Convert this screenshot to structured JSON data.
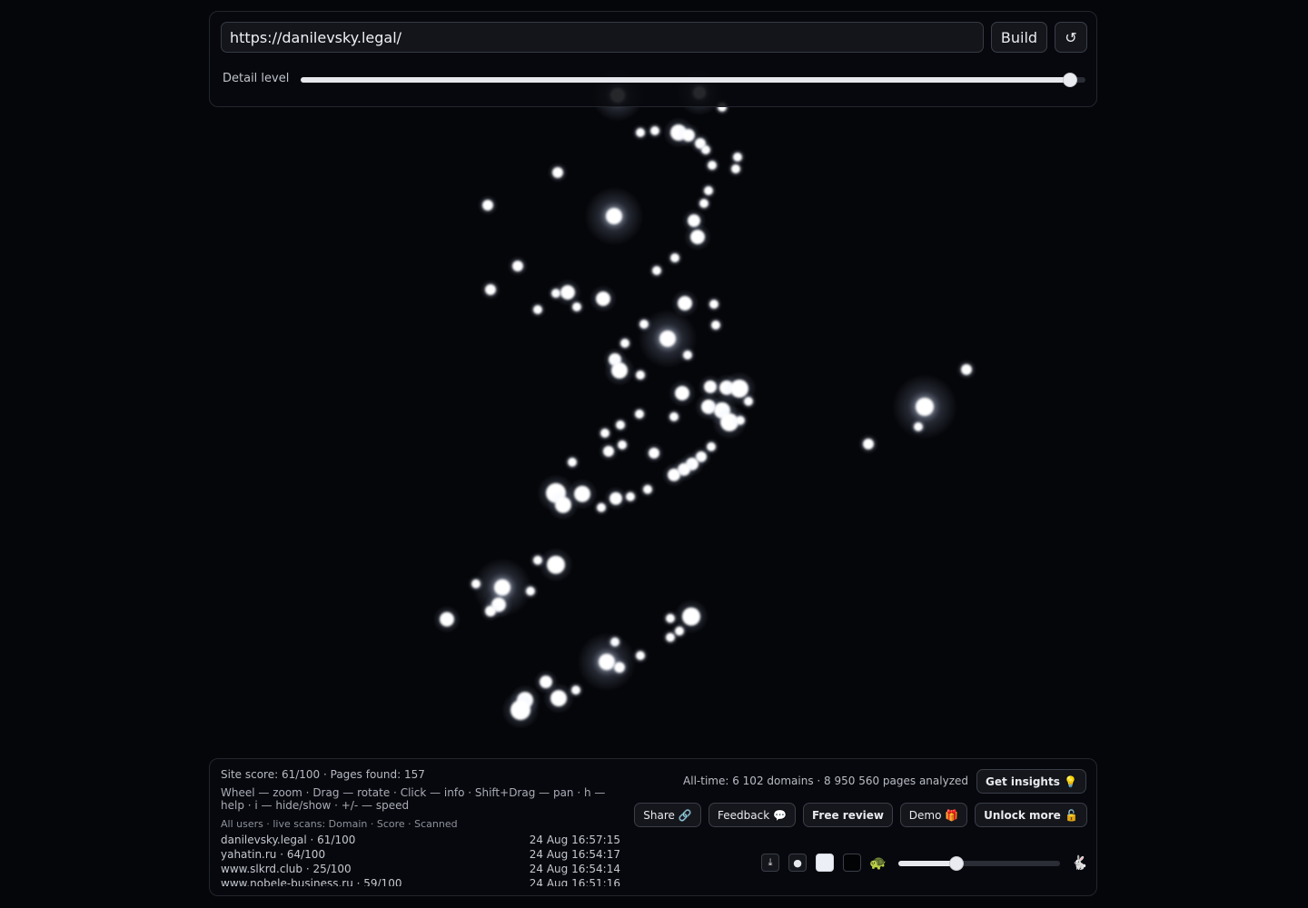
{
  "toolbar": {
    "url_value": "https://danilevsky.legal/",
    "build_label": "Build",
    "refresh_icon": "↺",
    "detail_label": "Detail level",
    "detail_value": 0.98
  },
  "status": {
    "summary": "Site score: 61/100 · Pages found: 157",
    "help": "Wheel — zoom · Drag — rotate · Click — info · Shift+Drag — pan · h — help · i — hide/show · +/- — speed",
    "feed_header": "All users · live scans: Domain · Score · Scanned",
    "feed": [
      {
        "domain": "danilevsky.legal · 61/100",
        "time": "24 Aug 16:57:15"
      },
      {
        "domain": "yahatin.ru · 64/100",
        "time": "24 Aug 16:54:17"
      },
      {
        "domain": "www.slkrd.club · 25/100",
        "time": "24 Aug 16:54:14"
      },
      {
        "domain": "www.nobele-business.ru · 59/100",
        "time": "24 Aug 16:51:16"
      }
    ]
  },
  "actions": {
    "stats": "All-time: 6 102 domains · 8 950 560 pages analyzed",
    "insights_label": "Get insights 💡",
    "share_label": "Share 🔗",
    "feedback_label": "Feedback 💬",
    "free_review_label": "Free review",
    "demo_label": "Demo 🎁",
    "unlock_label": "Unlock more 🔓"
  },
  "controls": {
    "download_icon": "⤓",
    "dot_icon": "●",
    "turtle_icon": "🐢",
    "rabbit_icon": "🐇",
    "speed_value": 0.36
  },
  "colors": {
    "background": "#05060a",
    "node": "#ffffff",
    "glow": "#c9d8ff"
  }
}
